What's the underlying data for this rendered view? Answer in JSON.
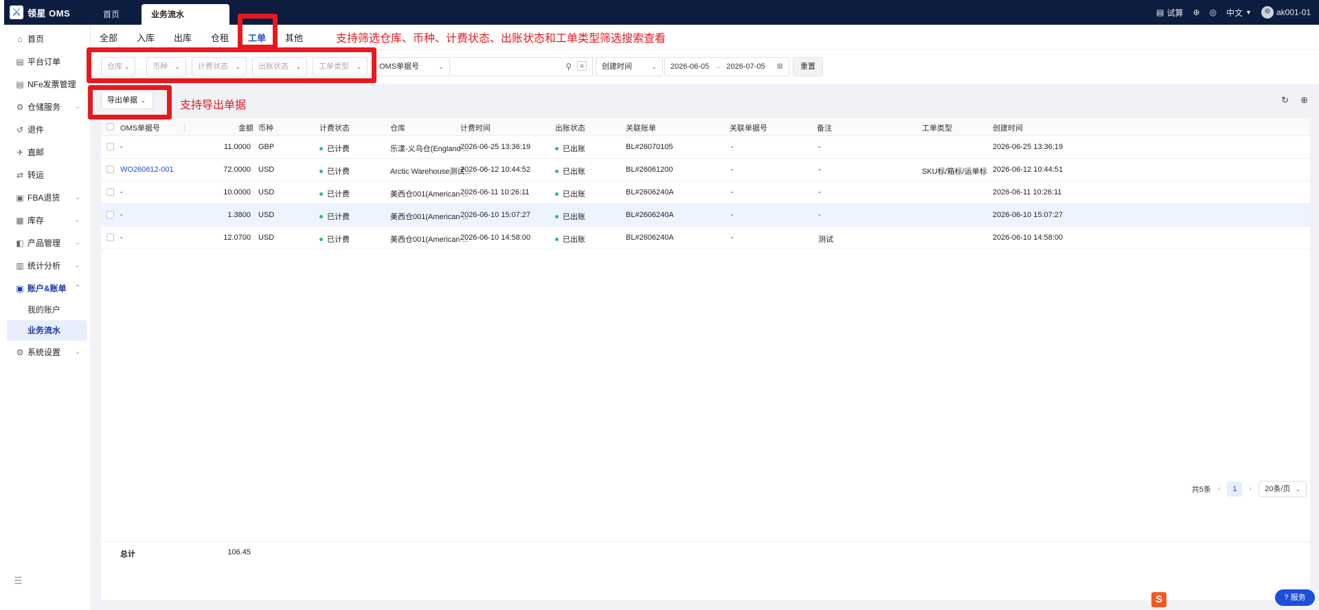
{
  "app": {
    "title": "领星 OMS",
    "logo_glyph": "⚔"
  },
  "top_tabs": [
    {
      "label": "首页"
    },
    {
      "label": "业务流水"
    }
  ],
  "top_right": {
    "trial": "试算",
    "lang": "中文",
    "user": "ak001-01"
  },
  "sidebar": {
    "items": [
      {
        "label": "首页",
        "icon": "home-icon",
        "glyph": "⌂",
        "expandable": false
      },
      {
        "label": "平台订单",
        "icon": "order-icon",
        "glyph": "▤",
        "expandable": false
      },
      {
        "label": "NFe发票管理",
        "icon": "invoice-icon",
        "glyph": "▤",
        "expandable": false
      },
      {
        "label": "仓储服务",
        "icon": "warehouse-icon",
        "glyph": "⚙",
        "expandable": true
      },
      {
        "label": "退件",
        "icon": "return-icon",
        "glyph": "↺",
        "expandable": false
      },
      {
        "label": "直邮",
        "icon": "mail-icon",
        "glyph": "✈",
        "expandable": false
      },
      {
        "label": "转运",
        "icon": "transfer-icon",
        "glyph": "⇄",
        "expandable": false
      },
      {
        "label": "FBA退货",
        "icon": "fba-icon",
        "glyph": "▣",
        "expandable": true
      },
      {
        "label": "库存",
        "icon": "inventory-icon",
        "glyph": "▦",
        "expandable": true
      },
      {
        "label": "产品管理",
        "icon": "product-icon",
        "glyph": "◧",
        "expandable": true
      },
      {
        "label": "统计分析",
        "icon": "stats-icon",
        "glyph": "▥",
        "expandable": true
      },
      {
        "label": "账户&账单",
        "icon": "account-icon",
        "glyph": "▣",
        "expandable": true
      }
    ],
    "sub_items": [
      {
        "label": "我的账户"
      },
      {
        "label": "业务流水"
      }
    ],
    "settings": {
      "label": "系统设置",
      "icon": "settings-icon",
      "glyph": "⚙"
    }
  },
  "sub_tabs": [
    {
      "label": "全部"
    },
    {
      "label": "入库"
    },
    {
      "label": "出库"
    },
    {
      "label": "仓租"
    },
    {
      "label": "工单"
    },
    {
      "label": "其他"
    }
  ],
  "active_sub_tab": "工单",
  "filters": {
    "warehouse": "仓库",
    "currency": "币种",
    "billing_status": "计费状态",
    "bill_status": "出账状态",
    "workorder_type": "工单类型",
    "search_field": "OMS单据号",
    "search_value": "",
    "date_field": "创建时间",
    "date_start": "2026-06-05",
    "date_end": "2026-07-05",
    "reset": "重置"
  },
  "toolbar": {
    "export": "导出单据"
  },
  "annotations": {
    "filter_note": "支持筛选仓库、币种、计费状态、出账状态和工单类型筛选搜索查看",
    "export_note": "支持导出单据"
  },
  "table": {
    "columns": [
      "OMS单据号",
      "金额",
      "币种",
      "计费状态",
      "仓库",
      "计费时间",
      "出账状态",
      "关联账单",
      "关联单据号",
      "备注",
      "工单类型",
      "创建时间"
    ],
    "rows": [
      {
        "oms_no": "-",
        "amount": "11.0000",
        "currency": "GBP",
        "billing": "已计费",
        "warehouse": "乐漾-义乌仓(England ...",
        "billing_time": "2026-06-25 13:36:19",
        "bill_status": "已出账",
        "bill": "BL#26070105",
        "rel_no": "-",
        "remark": "-",
        "wo_type": "",
        "created": "2026-06-25 13:36:19"
      },
      {
        "oms_no": "WO260612-001",
        "amount": "72.0000",
        "currency": "USD",
        "billing": "已计费",
        "warehouse": "Arctic Warehouse测试...",
        "billing_time": "2026-06-12 10:44:52",
        "bill_status": "已出账",
        "bill": "BL#26061200",
        "rel_no": "-",
        "remark": "-",
        "wo_type": "SKU标/箱标/运单标",
        "created": "2026-06-12 10:44:51"
      },
      {
        "oms_no": "-",
        "amount": "10.0000",
        "currency": "USD",
        "billing": "已计费",
        "warehouse": "美西仓001(American ...",
        "billing_time": "2026-06-11 10:26:11",
        "bill_status": "已出账",
        "bill": "BL#2606240A",
        "rel_no": "-",
        "remark": "-",
        "wo_type": "",
        "created": "2026-06-11 10:26:11"
      },
      {
        "oms_no": "-",
        "amount": "1.3800",
        "currency": "USD",
        "billing": "已计费",
        "warehouse": "美西仓001(American ...",
        "billing_time": "2026-06-10 15:07:27",
        "bill_status": "已出账",
        "bill": "BL#2606240A",
        "rel_no": "-",
        "remark": "-",
        "wo_type": "",
        "created": "2026-06-10 15:07:27"
      },
      {
        "oms_no": "-",
        "amount": "12.0700",
        "currency": "USD",
        "billing": "已计费",
        "warehouse": "美西仓001(American ...",
        "billing_time": "2026-06-10 14:58:00",
        "bill_status": "已出账",
        "bill": "BL#2606240A",
        "rel_no": "-",
        "remark": "测试",
        "wo_type": "",
        "created": "2026-06-10 14:58:00"
      }
    ],
    "total_label": "总计",
    "total_amount": "106.45"
  },
  "pagination": {
    "total": "共5条",
    "current": "1",
    "page_size": "20条/页"
  },
  "service_button": "服务",
  "ime_glyph": "S",
  "colors": {
    "accent": "#1d4fd8",
    "topbar": "#0d1d3f",
    "annotation": "#e8181d",
    "status_dot": "#2bbd6e"
  }
}
